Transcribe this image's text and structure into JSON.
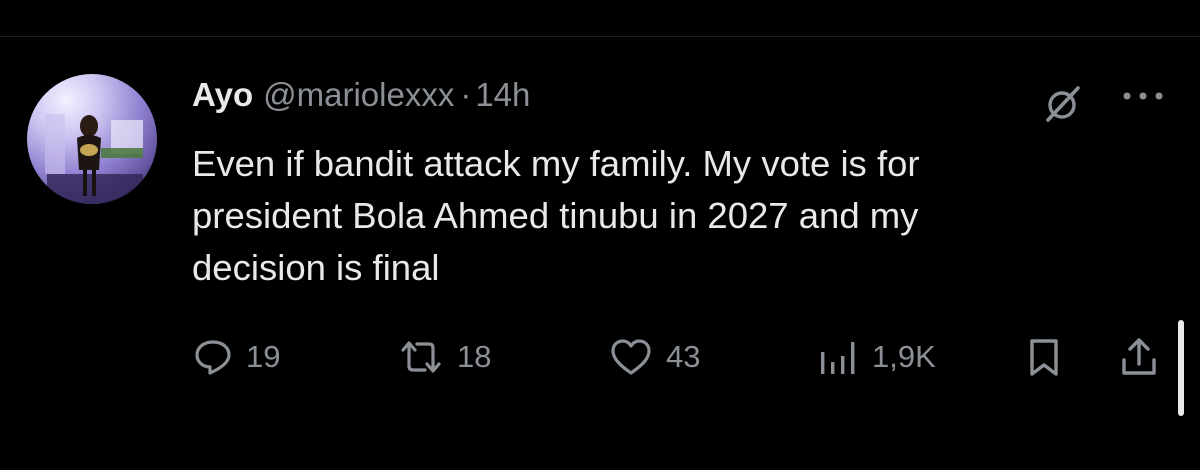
{
  "tweet": {
    "author_name": "Ayo",
    "author_handle": "@mariolexxx",
    "separator": "·",
    "timestamp": "14h",
    "text": "Even if bandit attack my family. My vote is for\npresident Bola Ahmed tinubu in 2027 and my\ndecision is final"
  },
  "actions": {
    "replies": "19",
    "reposts": "18",
    "likes": "43",
    "views": "1,9K"
  },
  "icons": {
    "grok": "grok-icon",
    "more": "more-icon",
    "reply": "reply-icon",
    "repost": "repost-icon",
    "like": "heart-icon",
    "views": "views-icon",
    "bookmark": "bookmark-icon",
    "share": "share-icon"
  },
  "colors": {
    "background": "#000000",
    "text": "#e7e9ea",
    "secondary": "#8b9096"
  }
}
